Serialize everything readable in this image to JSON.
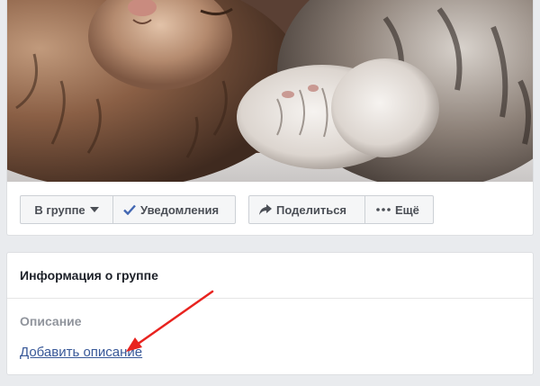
{
  "actions": {
    "join_label": "В группе",
    "notify_label": "Уведомления",
    "share_label": "Поделиться",
    "more_label": "Ещё"
  },
  "info": {
    "title": "Информация о группе",
    "section_label": "Описание",
    "add_description_link": "Добавить описание"
  },
  "colors": {
    "link": "#385898",
    "check_accent": "#4267b2",
    "annotation_arrow": "#e8231f",
    "page_background": "#e9ebee"
  },
  "icons": {
    "join_caret": "caret-down-icon",
    "notify": "checkmark-icon",
    "share": "share-arrow-icon",
    "more": "ellipsis-icon"
  }
}
